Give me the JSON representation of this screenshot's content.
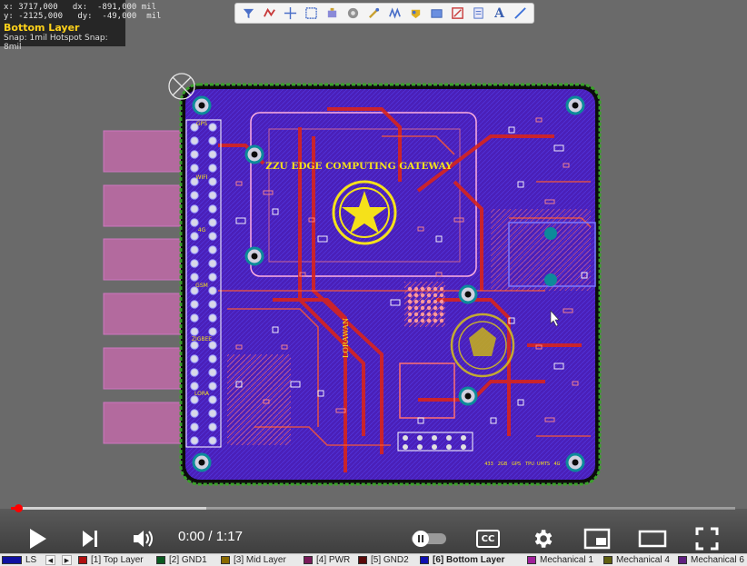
{
  "hud": {
    "x_label": "x:",
    "x_value": "3717,000",
    "dx_label": "dx:",
    "dx_value": "-891,000 mil",
    "y_label": "y:",
    "y_value": "-2125,000",
    "dy_label": "dy:",
    "dy_value": "-49,000  mil",
    "layer": "Bottom Layer",
    "snap": "Snap: 1mil Hotspot Snap: 8mil"
  },
  "toolbar": {
    "tools": [
      {
        "icon": "filter-icon"
      },
      {
        "icon": "interactive-route-icon"
      },
      {
        "icon": "crosshair-icon"
      },
      {
        "icon": "select-rectangle-icon"
      },
      {
        "icon": "component-icon"
      },
      {
        "icon": "pad-icon"
      },
      {
        "icon": "via-tool-icon"
      },
      {
        "icon": "diff-pair-icon"
      },
      {
        "icon": "polygon-pour-icon"
      },
      {
        "icon": "region-icon"
      },
      {
        "icon": "dimension-icon"
      },
      {
        "icon": "keepout-icon"
      },
      {
        "icon": "text-string-icon"
      },
      {
        "icon": "line-tool-icon"
      }
    ],
    "text_glyph": "A"
  },
  "board": {
    "silk_title": "ZZU EDGE COMPUTING GATEWAY",
    "silk_lora": "LORAWAN",
    "connector_labels": [
      "GPS",
      "WIFI",
      "4G",
      "GSM",
      "ZIGBEE",
      "LORA"
    ],
    "bottom_labels": [
      "433",
      "2GB",
      "GPS",
      "TPU",
      "UMTS",
      "4G"
    ],
    "colors": {
      "board": "#4a1fb8",
      "copper_top": "#d8241c",
      "copper_bottom": "#3838ff",
      "silk": "#f5e11a",
      "outline": "#3aa02a"
    }
  },
  "player": {
    "time_current": "0:00",
    "time_separator": " / ",
    "time_total": "1:17",
    "progress": 0.01,
    "buffered": 0.27,
    "cc_label": "CC"
  },
  "layers": {
    "current": "LS",
    "tabs": [
      {
        "label": "[1] Top Layer",
        "color": "#b01010"
      },
      {
        "label": "[2] GND1",
        "color": "#0a5a20"
      },
      {
        "label": "[3] Mid Layer",
        "color": "#8a6a00"
      },
      {
        "label": "[4] PWR",
        "color": "#7a1a5a"
      },
      {
        "label": "[5] GND2",
        "color": "#5a0a0a"
      },
      {
        "label": "[6] Bottom Layer",
        "color": "#1010b0",
        "active": true
      },
      {
        "label": "Mechanical 1",
        "color": "#a0209a"
      },
      {
        "label": "Mechanical 4",
        "color": "#606010"
      },
      {
        "label": "Mechanical 6",
        "color": "#602080"
      }
    ],
    "current_color": "#1010a0"
  }
}
